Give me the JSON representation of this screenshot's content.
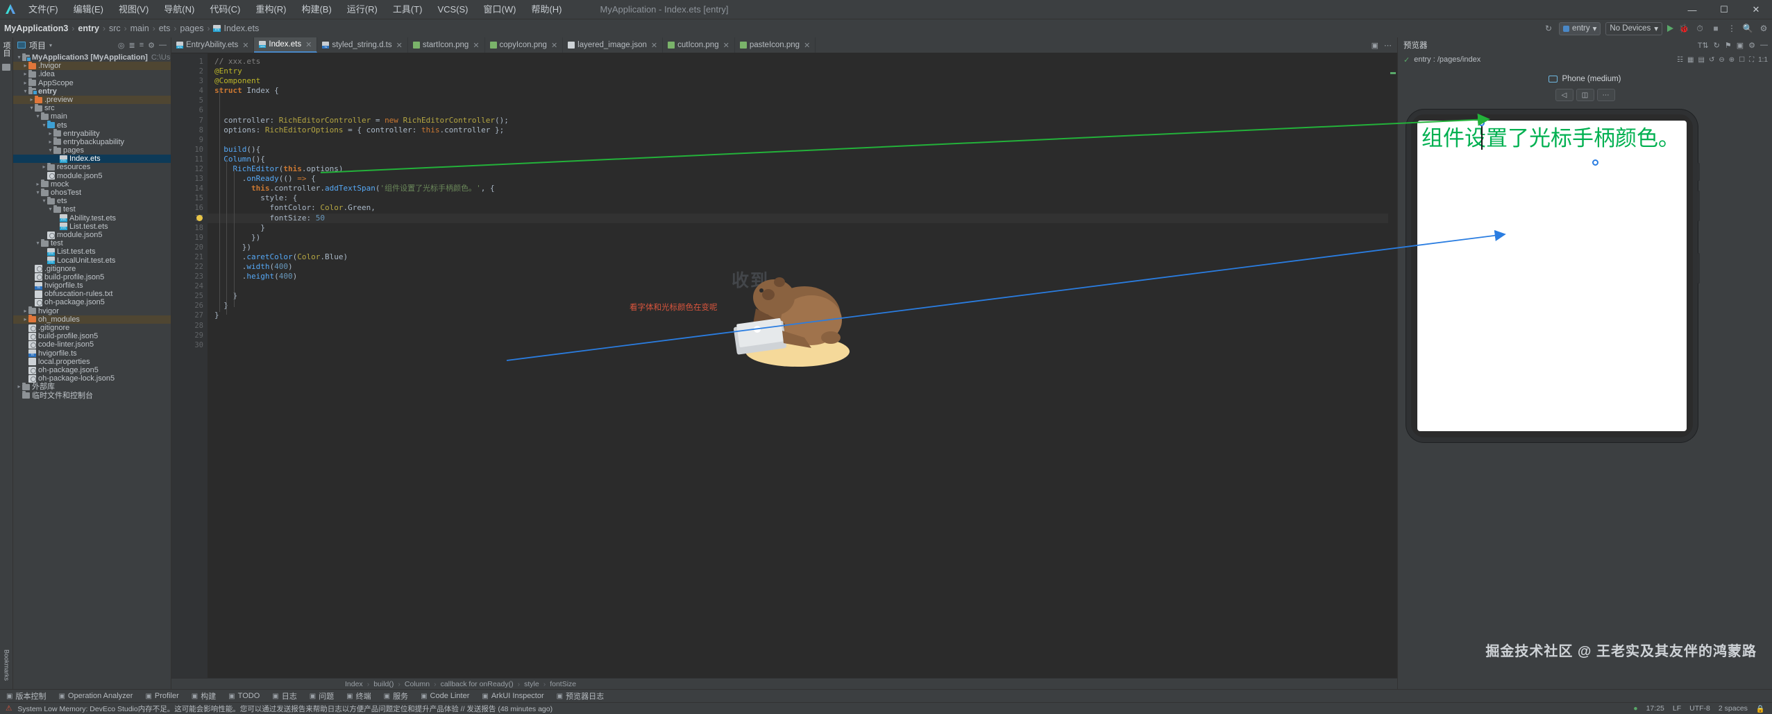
{
  "window": {
    "title": "MyApplication - Index.ets [entry]",
    "minimize": "—",
    "maximize": "☐",
    "close": "✕"
  },
  "menu": {
    "items": [
      "文件(F)",
      "编辑(E)",
      "视图(V)",
      "导航(N)",
      "代码(C)",
      "重构(R)",
      "构建(B)",
      "运行(R)",
      "工具(T)",
      "VCS(S)",
      "窗口(W)",
      "帮助(H)"
    ]
  },
  "breadcrumb": {
    "items": [
      "MyApplication3",
      "entry",
      "src",
      "main",
      "ets",
      "pages",
      "Index.ets"
    ],
    "separator": "›"
  },
  "navbar_right": {
    "run_config": "entry",
    "device": "No Devices",
    "run_label": "▶",
    "debug_label": "🐞",
    "profile_label": "⏱",
    "stop_label": "■",
    "search_label": "🔍",
    "settings_label": "⚙",
    "chevron": "▾"
  },
  "toolstrip": {
    "project_label": "项目",
    "structure_label": "结构",
    "bookmarks_label": "Bookmarks"
  },
  "project_panel": {
    "title": "项目",
    "chevron": "▾",
    "tree": [
      {
        "label": "MyApplication3 [MyApplication]",
        "path_hint": "C:\\Users\\MSN\\DevEcoS",
        "depth": 0,
        "arrow": "∨",
        "icon": "module",
        "bold": true
      },
      {
        "label": ".hvigor",
        "depth": 1,
        "arrow": "›",
        "icon": "folder-orange",
        "modified": true
      },
      {
        "label": ".idea",
        "depth": 1,
        "arrow": "›",
        "icon": "folder-grey"
      },
      {
        "label": "AppScope",
        "depth": 1,
        "arrow": "›",
        "icon": "folder-grey"
      },
      {
        "label": "entry",
        "depth": 1,
        "arrow": "∨",
        "icon": "module",
        "bold": true
      },
      {
        "label": ".preview",
        "depth": 2,
        "arrow": "›",
        "icon": "folder-orange",
        "modified": true
      },
      {
        "label": "src",
        "depth": 2,
        "arrow": "∨",
        "icon": "folder-grey"
      },
      {
        "label": "main",
        "depth": 3,
        "arrow": "∨",
        "icon": "folder-grey"
      },
      {
        "label": "ets",
        "depth": 4,
        "arrow": "∨",
        "icon": "folder-blue"
      },
      {
        "label": "entryability",
        "depth": 5,
        "arrow": "›",
        "icon": "folder-grey"
      },
      {
        "label": "entrybackupability",
        "depth": 5,
        "arrow": "›",
        "icon": "folder-grey"
      },
      {
        "label": "pages",
        "depth": 5,
        "arrow": "∨",
        "icon": "folder-grey"
      },
      {
        "label": "Index.ets",
        "depth": 6,
        "arrow": "",
        "icon": "ets",
        "selected": true
      },
      {
        "label": "resources",
        "depth": 4,
        "arrow": "›",
        "icon": "folder-grey"
      },
      {
        "label": "module.json5",
        "depth": 4,
        "arrow": "",
        "icon": "json5"
      },
      {
        "label": "mock",
        "depth": 3,
        "arrow": "›",
        "icon": "folder-grey"
      },
      {
        "label": "ohosTest",
        "depth": 3,
        "arrow": "∨",
        "icon": "folder-grey"
      },
      {
        "label": "ets",
        "depth": 4,
        "arrow": "∨",
        "icon": "folder-grey"
      },
      {
        "label": "test",
        "depth": 5,
        "arrow": "∨",
        "icon": "folder-grey"
      },
      {
        "label": "Ability.test.ets",
        "depth": 6,
        "arrow": "",
        "icon": "ets"
      },
      {
        "label": "List.test.ets",
        "depth": 6,
        "arrow": "",
        "icon": "ets"
      },
      {
        "label": "module.json5",
        "depth": 4,
        "arrow": "",
        "icon": "json5"
      },
      {
        "label": "test",
        "depth": 3,
        "arrow": "∨",
        "icon": "folder-grey"
      },
      {
        "label": "List.test.ets",
        "depth": 4,
        "arrow": "",
        "icon": "ets"
      },
      {
        "label": "LocalUnit.test.ets",
        "depth": 4,
        "arrow": "",
        "icon": "ets"
      },
      {
        "label": ".gitignore",
        "depth": 2,
        "arrow": "",
        "icon": "gitignore"
      },
      {
        "label": "build-profile.json5",
        "depth": 2,
        "arrow": "",
        "icon": "json5"
      },
      {
        "label": "hvigorfile.ts",
        "depth": 2,
        "arrow": "",
        "icon": "ts"
      },
      {
        "label": "obfuscation-rules.txt",
        "depth": 2,
        "arrow": "",
        "icon": "txt"
      },
      {
        "label": "oh-package.json5",
        "depth": 2,
        "arrow": "",
        "icon": "json5"
      },
      {
        "label": "hvigor",
        "depth": 1,
        "arrow": "›",
        "icon": "folder-grey"
      },
      {
        "label": "oh_modules",
        "depth": 1,
        "arrow": "›",
        "icon": "folder-orange",
        "modified": true
      },
      {
        "label": ".gitignore",
        "depth": 1,
        "arrow": "",
        "icon": "gitignore"
      },
      {
        "label": "build-profile.json5",
        "depth": 1,
        "arrow": "",
        "icon": "json5"
      },
      {
        "label": "code-linter.json5",
        "depth": 1,
        "arrow": "",
        "icon": "json5"
      },
      {
        "label": "hvigorfile.ts",
        "depth": 1,
        "arrow": "",
        "icon": "ts"
      },
      {
        "label": "local.properties",
        "depth": 1,
        "arrow": "",
        "icon": "prop"
      },
      {
        "label": "oh-package.json5",
        "depth": 1,
        "arrow": "",
        "icon": "json5"
      },
      {
        "label": "oh-package-lock.json5",
        "depth": 1,
        "arrow": "",
        "icon": "json5"
      },
      {
        "label": "外部库",
        "depth": 0,
        "arrow": "›",
        "icon": "lib"
      },
      {
        "label": "临时文件和控制台",
        "depth": 0,
        "arrow": "",
        "icon": "scratch"
      }
    ]
  },
  "editor_tabs": [
    {
      "label": "EntryAbility.ets",
      "icon": "ets",
      "active": false,
      "close": "✕"
    },
    {
      "label": "Index.ets",
      "icon": "ets",
      "active": true,
      "close": "✕"
    },
    {
      "label": "styled_string.d.ts",
      "icon": "ts",
      "active": false,
      "close": "✕"
    },
    {
      "label": "startIcon.png",
      "icon": "png",
      "active": false,
      "close": "✕"
    },
    {
      "label": "copyIcon.png",
      "icon": "png",
      "active": false,
      "close": "✕"
    },
    {
      "label": "layered_image.json",
      "icon": "json",
      "active": false,
      "close": "✕"
    },
    {
      "label": "cutIcon.png",
      "icon": "png",
      "active": false,
      "close": "✕"
    },
    {
      "label": "pasteIcon.png",
      "icon": "png",
      "active": false,
      "close": "✕"
    }
  ],
  "code": {
    "first_line": 1,
    "total_lines": 30,
    "lines": [
      {
        "n": 1,
        "html": "<span class='cmt'>// xxx.ets</span>"
      },
      {
        "n": 2,
        "html": "<span class='ann'>@Entry</span>"
      },
      {
        "n": 3,
        "html": "<span class='ann'>@Component</span>"
      },
      {
        "n": 4,
        "html": "<span class='kw2'>struct</span> <span class='cls'>Index</span> <span class='pl'>{</span>",
        "fold": true
      },
      {
        "n": 5,
        "html": ""
      },
      {
        "n": 6,
        "html": ""
      },
      {
        "n": 7,
        "html": "  <span class='pl'>controller</span><span class='pl'>:</span> <span class='typ'>RichEditorController</span> <span class='pl'>=</span> <span class='kw'>new</span> <span class='typ'>RichEditorController</span><span class='pl'>();</span>"
      },
      {
        "n": 8,
        "html": "  <span class='pl'>options</span><span class='pl'>:</span> <span class='typ'>RichEditorOptions</span> <span class='pl'>=</span> <span class='pl'>{ controller: </span><span class='kw'>this</span><span class='pl'>.controller };</span>"
      },
      {
        "n": 9,
        "html": ""
      },
      {
        "n": 10,
        "html": "  <span class='fn'>build</span><span class='pl'>(){</span>",
        "fold": true
      },
      {
        "n": 11,
        "html": "  <span class='fn'>Column</span><span class='pl'>(){</span>",
        "fold": true
      },
      {
        "n": 12,
        "html": "    <span class='fn'>RichEditor</span><span class='pl'>(</span><span class='kw2'>this</span><span class='pl'>.options)</span>"
      },
      {
        "n": 13,
        "html": "      <span class='pl'>.</span><span class='fn'>onReady</span><span class='pl'>(() </span><span class='kw'>=&gt;</span><span class='pl'> {</span>",
        "fold": true
      },
      {
        "n": 14,
        "html": "        <span class='kw2'>this</span><span class='pl'>.controller.</span><span class='fn'>addTextSpan</span><span class='pl'>(</span><span class='str'>'组件设置了光标手柄颜色。'</span><span class='pl'>, {</span>",
        "fold": true
      },
      {
        "n": 15,
        "html": "          <span class='pl'>style: {</span>",
        "fold": true
      },
      {
        "n": 16,
        "html": "            <span class='pl'>fontColor: </span><span class='typ'>Color</span><span class='pl'>.Green,</span>"
      },
      {
        "n": 17,
        "html": "            <span class='pl'>fontSize: </span><span class='num'>50</span>",
        "bulb": true,
        "highlight": true
      },
      {
        "n": 18,
        "html": "          <span class='pl'>}</span>"
      },
      {
        "n": 19,
        "html": "        <span class='pl'>})</span>"
      },
      {
        "n": 20,
        "html": "      <span class='pl'>})</span>"
      },
      {
        "n": 21,
        "html": "      <span class='pl'>.</span><span class='fn'>caretColor</span><span class='pl'>(</span><span class='typ'>Color</span><span class='pl'>.Blue)</span>"
      },
      {
        "n": 22,
        "html": "      <span class='pl'>.</span><span class='fn'>width</span><span class='pl'>(</span><span class='num'>400</span><span class='pl'>)</span>"
      },
      {
        "n": 23,
        "html": "      <span class='pl'>.</span><span class='fn'>height</span><span class='pl'>(</span><span class='num'>400</span><span class='pl'>)</span>"
      },
      {
        "n": 24,
        "html": ""
      },
      {
        "n": 25,
        "html": "    <span class='pl'>}</span>",
        "fold": true
      },
      {
        "n": 26,
        "html": "  <span class='pl'>}</span>",
        "fold": true
      },
      {
        "n": 27,
        "html": "<span class='pl'>}</span>"
      },
      {
        "n": 28,
        "html": ""
      },
      {
        "n": 29,
        "html": ""
      },
      {
        "n": 30,
        "html": ""
      }
    ]
  },
  "annotations": {
    "capybara_text": "收到",
    "red_note": "看字体和光标颜色在变呢"
  },
  "editor_breadcrumb": {
    "items": [
      "Index",
      "build()",
      "Column",
      "callback for onReady()",
      "style",
      "fontSize"
    ],
    "separator": "›"
  },
  "preview": {
    "title": "预览器",
    "entry_path": "entry : /pages/index",
    "device": "Phone (medium)",
    "device_icon": "phone-icon",
    "tool_buttons": [
      "◁",
      "◫",
      "⋯"
    ],
    "rich_text": "组件设置了光标手柄颜色。",
    "text_color": "#00b050",
    "caret_color": "#2a7de1"
  },
  "watermark": "掘金技术社区 @ 王老实及其友伴的鸿蒙路",
  "bottom_bar": {
    "items": [
      {
        "label": "版本控制",
        "icon": "branch-icon"
      },
      {
        "label": "Operation Analyzer",
        "icon": "analyzer-icon"
      },
      {
        "label": "Profiler",
        "icon": "profiler-icon"
      },
      {
        "label": "构建",
        "icon": "hammer-icon"
      },
      {
        "label": "TODO",
        "icon": "todo-icon"
      },
      {
        "label": "日志",
        "icon": "log-icon"
      },
      {
        "label": "问题",
        "icon": "problem-icon"
      },
      {
        "label": "终端",
        "icon": "terminal-icon"
      },
      {
        "label": "服务",
        "icon": "services-icon"
      },
      {
        "label": "Code Linter",
        "icon": "linter-icon"
      },
      {
        "label": "ArkUI Inspector",
        "icon": "inspector-icon"
      },
      {
        "label": "预览器日志",
        "icon": "previewer-log-icon"
      }
    ]
  },
  "status_bar": {
    "message": "System Low Memory: DevEco Studio内存不足。这可能会影响性能。您可以通过发送报告来帮助日志以方便产品问题定位和提升产品体验 // 发送报告 (48 minutes ago)",
    "time": "17:25",
    "line_sep": "LF",
    "encoding": "UTF-8",
    "indent": "2 spaces",
    "lock_icon": "lock-icon",
    "warn_icon": "warning-icon"
  }
}
